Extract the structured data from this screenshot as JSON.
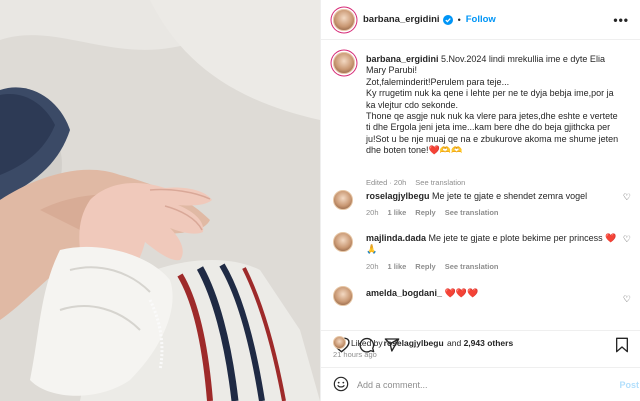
{
  "header": {
    "username": "barbana_ergidini",
    "dot": "•",
    "follow_label": "Follow",
    "more": "•••"
  },
  "caption": {
    "username": "barbana_ergidini",
    "text": " 5.Nov.2024 lindi mrekullia ime e dyte Elia Mary Parubi!\nZot,faleminderit!Perulem para teje...\nKy rrugetim nuk ka qene i lehte per ne te dyja bebja ime,por ja ka vlejtur cdo sekonde.\nThone qe asgje nuk nuk ka vlere para jetes,dhe eshte e vertete ti dhe Ergola jeni jeta ime...kam bere dhe do beja gjithcka per ju!Sot u be nje muaj qe na e zbukurove akoma me shume jeten dhe boten tone!❤️🫶🫶",
    "edited": "Edited",
    "time": "20h",
    "see_translation": "See translation"
  },
  "comments": [
    {
      "username": "roselagjylbegu",
      "text": " Me jete te gjate e shendet zemra vogel",
      "time": "20h",
      "likes": "1 like",
      "reply": "Reply",
      "translation": "See translation"
    },
    {
      "username": "majlinda.dada",
      "text": " Me jete te gjate e plote bekime per princess ❤️🙏",
      "time": "20h",
      "likes": "1 like",
      "reply": "Reply",
      "translation": "See translation"
    },
    {
      "username": "amelda_bogdani_",
      "text": " ❤️❤️❤️",
      "time": "",
      "likes": "",
      "reply": "",
      "translation": ""
    }
  ],
  "likes_line": {
    "prefix": "Liked by ",
    "user": "roselagjylbegu",
    "mid": " and ",
    "count": "2,943 others"
  },
  "time_ago": "21 hours ago",
  "comment_box": {
    "placeholder": "Add a comment...",
    "post_label": "Post"
  },
  "colors": {
    "accent": "#0095f6",
    "heart": "#e0245e",
    "muted": "#8e8e8e"
  },
  "icons": [
    "verified-badge-icon",
    "more-icon",
    "heart-icon",
    "comment-icon",
    "share-icon",
    "bookmark-icon",
    "emoji-icon"
  ]
}
